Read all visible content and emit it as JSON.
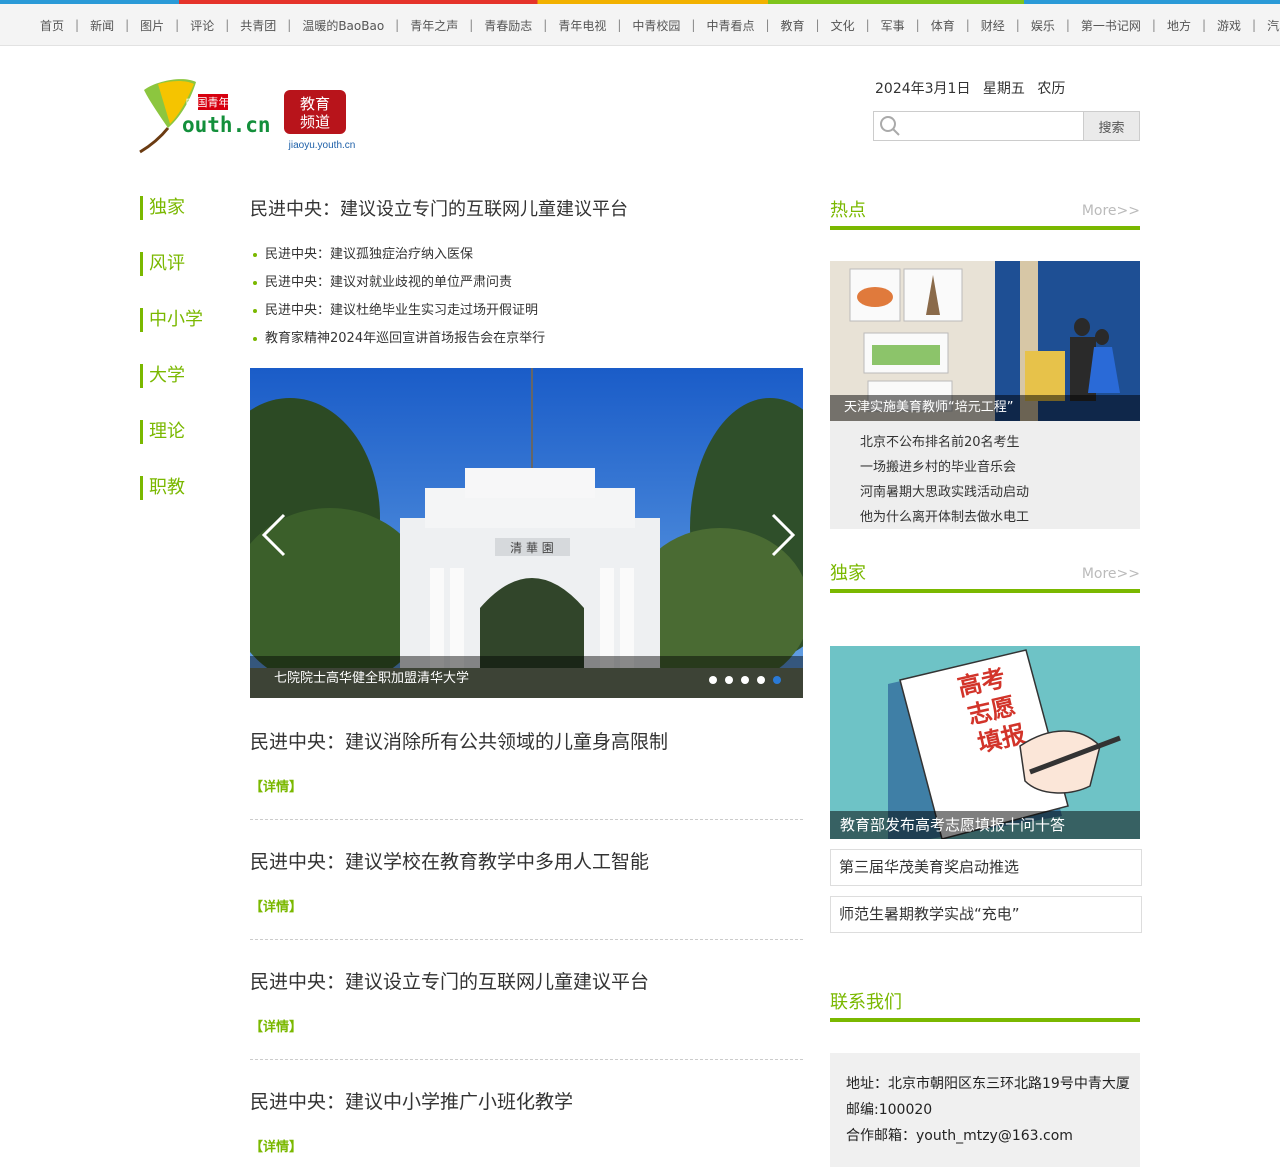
{
  "topnav": [
    "首页",
    "新闻",
    "图片",
    "评论",
    "共青团",
    "温暖的BaoBao",
    "青年之声",
    "青春励志",
    "青年电视",
    "中青校园",
    "中青看点",
    "教育",
    "文化",
    "军事",
    "体育",
    "财经",
    "娱乐",
    "第一书记网",
    "地方",
    "游戏",
    "汽车"
  ],
  "logo": {
    "site": "中国青年网",
    "domain_text": "outh.cn",
    "y_letter": "Y",
    "channel": "教育频道",
    "channel_line1": "教育",
    "channel_line2": "频道",
    "url": "jiaoyu.youth.cn"
  },
  "header": {
    "date": "2024年3月1日",
    "weekday": "星期五",
    "lunar": "农历"
  },
  "search": {
    "placeholder": "",
    "button": "搜索"
  },
  "sidenav": [
    "独家",
    "风评",
    "中小学",
    "大学",
    "理论",
    "职教"
  ],
  "main": {
    "headline": "民进中央：建议设立专门的互联网儿童建议平台",
    "bullets": [
      "民进中央：建议孤独症治疗纳入医保",
      "民进中央：建议对就业歧视的单位严肃问责",
      "民进中央：建议杜绝毕业生实习走过场开假证明",
      "教育家精神2024年巡回宣讲首场报告会在京举行"
    ],
    "slider": {
      "caption": "七院院士高华健全职加盟清华大学",
      "gate_text": "清 華 園",
      "dots": 5,
      "active_dot": 5
    },
    "articles": [
      {
        "title": "民进中央：建议消除所有公共领域的儿童身高限制",
        "more": "【详情】"
      },
      {
        "title": "民进中央：建议学校在教育教学中多用人工智能",
        "more": "【详情】"
      },
      {
        "title": "民进中央：建议设立专门的互联网儿童建议平台",
        "more": "【详情】"
      },
      {
        "title": "民进中央：建议中小学推广小班化教学",
        "more": "【详情】"
      }
    ]
  },
  "sidebar": {
    "hot": {
      "title": "热点",
      "more": "More>>",
      "image_caption": "天津实施美育教师“培元工程”",
      "list": [
        "北京不公布排名前20名考生",
        "一场搬进乡村的毕业音乐会",
        "河南暑期大思政实践活动启动",
        "他为什么离开体制去做水电工"
      ]
    },
    "exclusive": {
      "title": "独家",
      "more": "More>>",
      "image_caption": "教育部发布高考志愿填报十问十答",
      "image_text": [
        "高考",
        "志愿",
        "填报"
      ],
      "links": [
        "第三届华茂美育奖启动推选",
        "师范生暑期教学实战“充电”"
      ]
    },
    "contact": {
      "title": "联系我们",
      "address": "地址：北京市朝阳区东三环北路19号中青大厦",
      "postcode": "邮编:100020",
      "email": "合作邮箱：youth_mtzy@163.com"
    }
  },
  "colors": {
    "accent": "#7ab800",
    "nav_bg": "#f4f4f4",
    "dot_active": "#2a7ad7"
  }
}
